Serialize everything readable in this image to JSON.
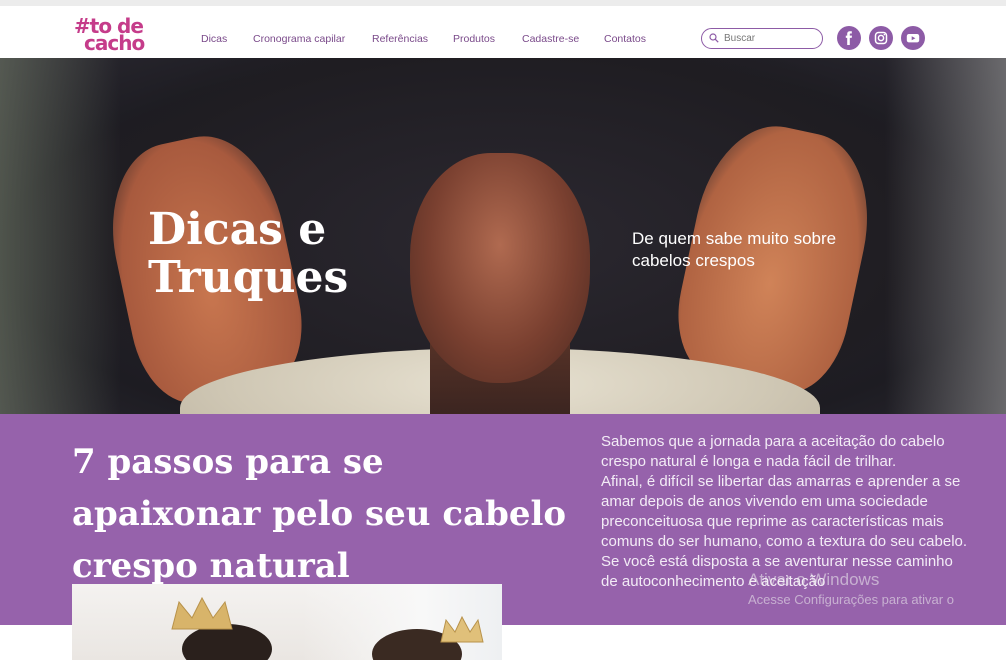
{
  "brand": {
    "logo_line1": "#to de",
    "logo_line2": "cacho",
    "accent_color": "#8d5ba6",
    "logo_color": "#c53c8a"
  },
  "nav": {
    "items": [
      {
        "label": "Dicas"
      },
      {
        "label": "Cronograma capilar"
      },
      {
        "label": "Referências"
      },
      {
        "label": "Produtos"
      },
      {
        "label": "Cadastre-se"
      },
      {
        "label": "Contatos"
      }
    ]
  },
  "search": {
    "placeholder": "Buscar",
    "icon": "search-icon"
  },
  "social": {
    "items": [
      {
        "icon": "facebook-icon"
      },
      {
        "icon": "instagram-icon"
      },
      {
        "icon": "youtube-icon"
      }
    ]
  },
  "hero": {
    "title": "Dicas e Truques",
    "subtitle": "De quem sabe muito sobre cabelos crespos"
  },
  "article": {
    "title": "7 passos para se apaixonar pelo seu cabelo crespo natural",
    "intro_p1": "Sabemos que a jornada para a aceitação do cabelo crespo natural é longa e nada fácil de trilhar.",
    "intro_p2": "Afinal, é difícil se libertar das amarras e aprender a se amar depois de anos vivendo em uma sociedade preconceituosa que reprime as características mais comuns do ser humano, como a textura do seu cabelo.",
    "intro_p3": "Se você está disposta a se aventurar nesse caminho de autoconhecimento e aceitação"
  },
  "watermark": {
    "line1": "Ativar o Windows",
    "line2": "Acesse Configurações para ativar o"
  },
  "band_color": "#9662ab"
}
